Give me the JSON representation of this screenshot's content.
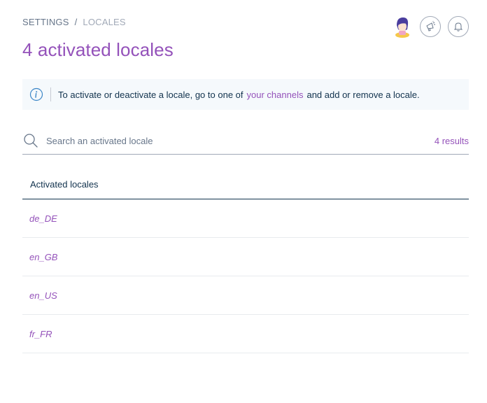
{
  "breadcrumb": {
    "settings": "SETTINGS",
    "separator": "/",
    "current": "LOCALES"
  },
  "title": "4 activated locales",
  "header": {
    "avatar_icon": "user-avatar-icon",
    "announcements_icon": "megaphone-icon",
    "notifications_icon": "bell-icon"
  },
  "info": {
    "icon": "info-icon",
    "text_before": "To activate or deactivate a locale, go to one of",
    "link": "your channels",
    "text_after": "and add or remove a locale."
  },
  "search": {
    "placeholder": "Search an activated locale",
    "value": "",
    "result_count": "4 results"
  },
  "table": {
    "header": "Activated locales",
    "rows": [
      "de_DE",
      "en_GB",
      "en_US",
      "fr_FR"
    ]
  },
  "colors": {
    "accent": "#9452ba",
    "text": "#11324d",
    "muted": "#67768a",
    "info_bg": "#f5f9fc"
  }
}
